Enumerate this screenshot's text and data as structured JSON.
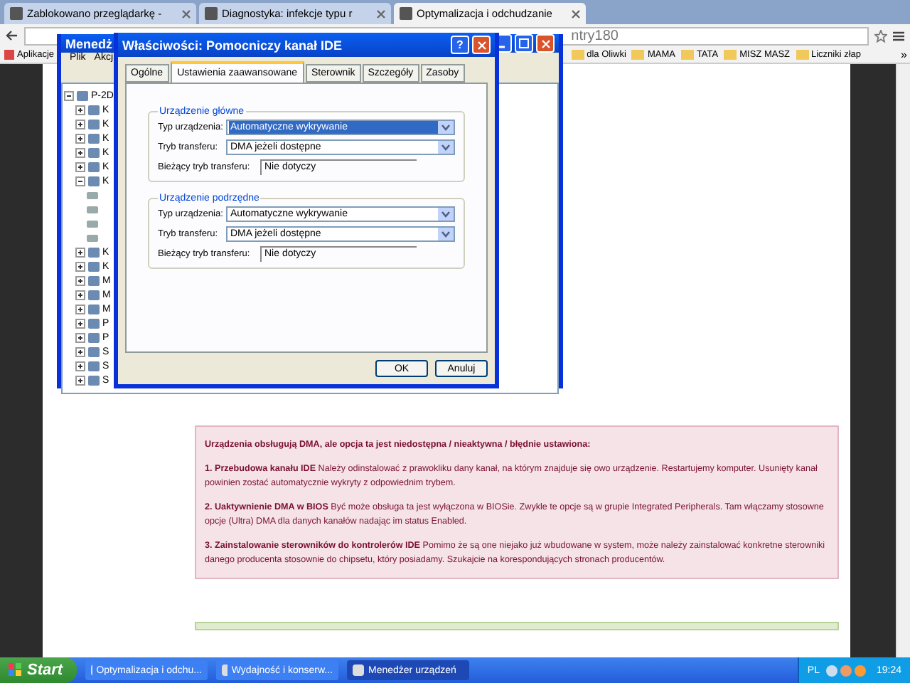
{
  "browser": {
    "tabs": [
      {
        "label": "Zablokowano przeglądarkę -",
        "selected": false
      },
      {
        "label": "Diagnostyka: infekcje typu r",
        "selected": false
      },
      {
        "label": "Optymalizacja i odchudzanie",
        "selected": true
      }
    ],
    "address": "ntry180",
    "bookmarks": [
      {
        "label": "Aplikacje",
        "kind": "apps"
      },
      {
        "label": "dla Oliwki",
        "kind": "folder"
      },
      {
        "label": "MAMA",
        "kind": "folder"
      },
      {
        "label": "TATA",
        "kind": "folder"
      },
      {
        "label": "MISZ MASZ",
        "kind": "folder"
      },
      {
        "label": "Liczniki złap",
        "kind": "folder"
      }
    ],
    "more": "»",
    "notice": {
      "heading": "Urządzenia obsługują DMA, ale opcja ta jest niedostępna / nieaktywna / błędnie ustawiona:",
      "paragraphs": [
        "**1. Przebudowa kanału IDE** Należy odinstalować z prawokliku dany kanał, na którym znajduje się owo urządzenie. Restartujemy komputer. Usunięty kanał powinien zostać automatycznie wykryty z odpowiednim trybem.",
        "**2. Uaktywnienie DMA w BIOS** Być może obsługa ta jest wyłączona w BIOSie. Zwykle te opcje są w grupie Integrated Peripherals. Tam włączamy stosowne opcje (Ultra) DMA dla danych kanałów nadając im status Enabled.",
        "**3. Zainstalowanie sterowników do kontrolerów IDE** Pomimo że są one niejako już wbudowane w system, może należy zainstalować konkretne sterowniki danego producenta stosownie do chipsetu, który posiadamy. Szukajcie na korespondujących stronach producentów."
      ]
    }
  },
  "device_manager": {
    "title": "Menedż",
    "menu": [
      "Plik",
      "Akcj"
    ],
    "tree": {
      "label": "P-2D",
      "expanded": true,
      "children": [
        {
          "label": "K",
          "expanded": false
        },
        {
          "label": "K",
          "expanded": false
        },
        {
          "label": "K",
          "expanded": false
        },
        {
          "label": "K",
          "expanded": false
        },
        {
          "label": "K",
          "expanded": false
        },
        {
          "label": "K",
          "expanded": true,
          "children": [
            {
              "kind": "channel"
            },
            {
              "kind": "channel"
            },
            {
              "kind": "channel"
            },
            {
              "kind": "channel"
            }
          ]
        },
        {
          "label": "K",
          "expanded": false
        },
        {
          "label": "K",
          "expanded": false
        },
        {
          "label": "M",
          "expanded": false
        },
        {
          "label": "M",
          "expanded": false
        },
        {
          "label": "M",
          "expanded": false
        },
        {
          "label": "P",
          "expanded": false
        },
        {
          "label": "P",
          "expanded": false
        },
        {
          "label": "S",
          "expanded": false
        },
        {
          "label": "S",
          "expanded": false
        },
        {
          "label": "S",
          "expanded": false
        }
      ]
    }
  },
  "dialog": {
    "title": "Właściwości: Pomocniczy kanał IDE",
    "help": "?",
    "tabs": [
      {
        "label": "Ogólne",
        "selected": false
      },
      {
        "label": "Ustawienia zaawansowane",
        "selected": true
      },
      {
        "label": "Sterownik",
        "selected": false
      },
      {
        "label": "Szczegóły",
        "selected": false
      },
      {
        "label": "Zasoby",
        "selected": false
      }
    ],
    "groups": [
      {
        "title": "Urządzenie główne",
        "fields": [
          {
            "label": "Typ urządzenia:",
            "kind": "dropdown",
            "value": "Automatyczne wykrywanie",
            "focused": true
          },
          {
            "label": "Tryb transferu:",
            "kind": "dropdown",
            "value": "DMA jeżeli dostępne",
            "focused": false
          },
          {
            "label": "Bieżący tryb transferu:",
            "kind": "readonly",
            "value": "Nie dotyczy"
          }
        ]
      },
      {
        "title": "Urządzenie podrzędne",
        "fields": [
          {
            "label": "Typ urządzenia:",
            "kind": "dropdown",
            "value": "Automatyczne wykrywanie",
            "focused": false
          },
          {
            "label": "Tryb transferu:",
            "kind": "dropdown",
            "value": "DMA jeżeli dostępne",
            "focused": false
          },
          {
            "label": "Bieżący tryb transferu:",
            "kind": "readonly",
            "value": "Nie dotyczy"
          }
        ]
      }
    ],
    "buttons": [
      "OK",
      "Anuluj"
    ]
  },
  "taskbar": {
    "start": "Start",
    "items": [
      {
        "label": "Optymalizacja i odchu...",
        "selected": false
      },
      {
        "label": "Wydajność i konserw...",
        "selected": false
      },
      {
        "label": "Menedżer urządzeń",
        "selected": true
      }
    ],
    "language": "PL",
    "time": "19:24"
  }
}
